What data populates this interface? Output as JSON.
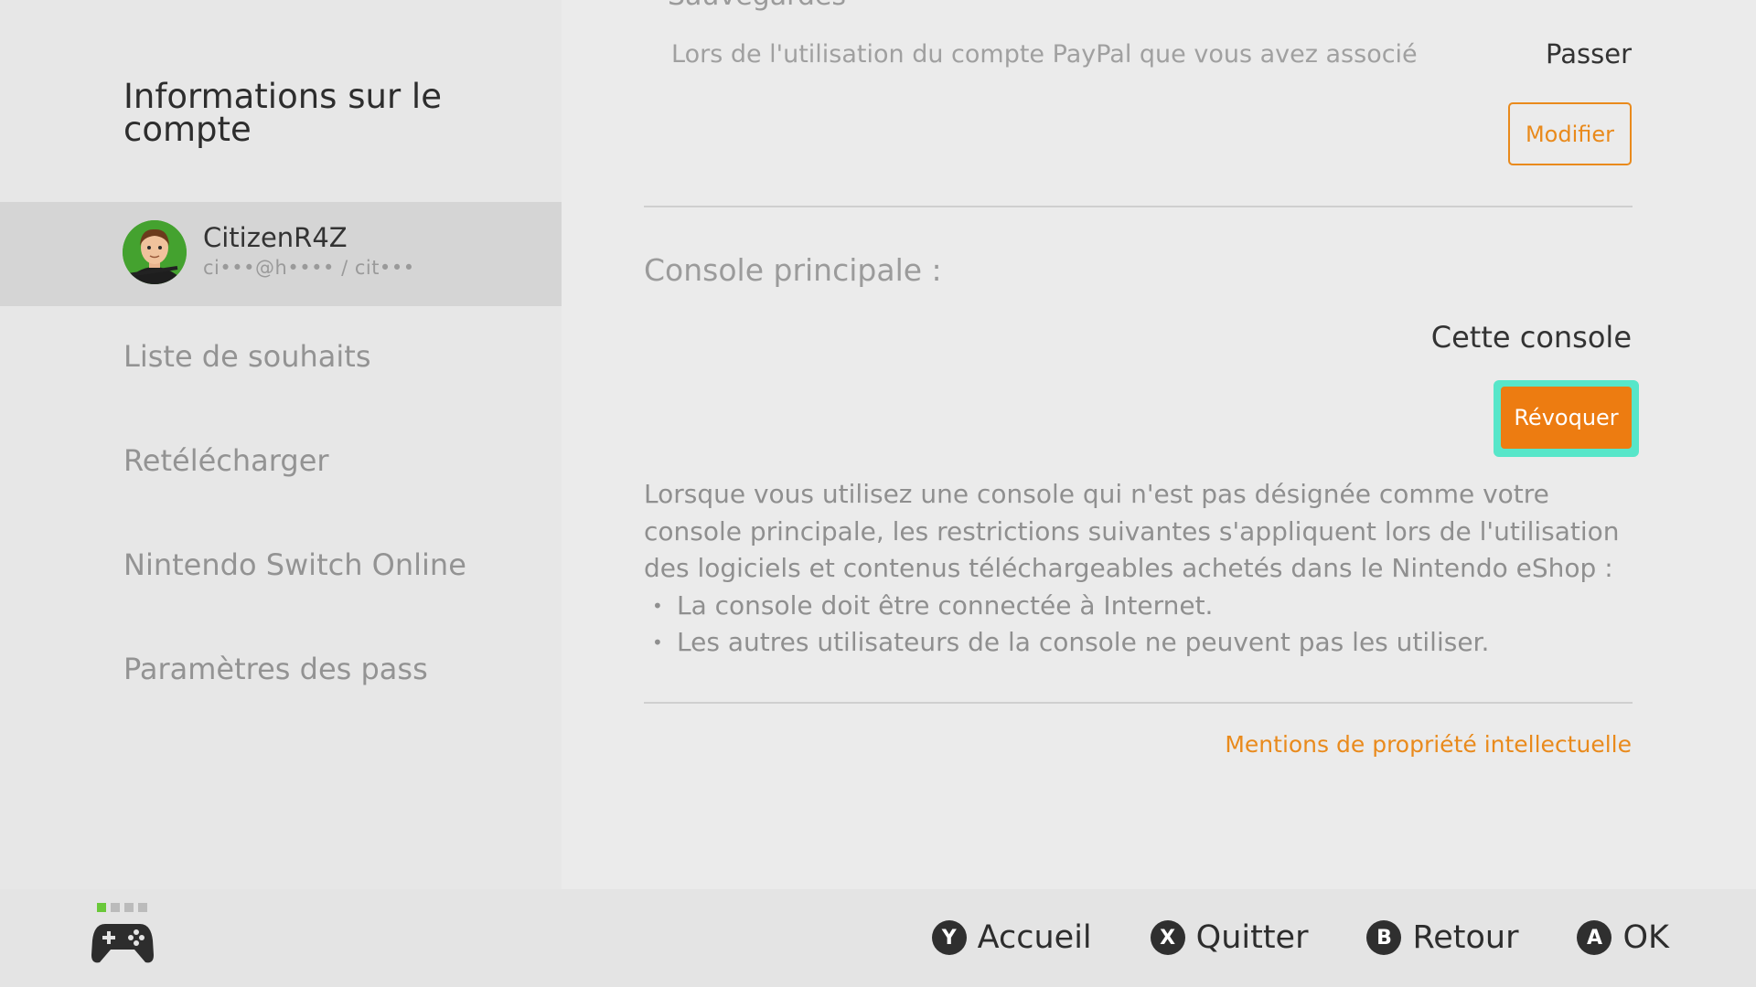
{
  "sidebar": {
    "title": "Informations sur le compte",
    "account": {
      "name": "CitizenR4Z",
      "sub": "ci•••@h•••• / cit•••"
    },
    "items": [
      {
        "label": "Liste de souhaits"
      },
      {
        "label": "Retélécharger"
      },
      {
        "label": "Nintendo Switch Online"
      },
      {
        "label": "Paramètres des pass"
      }
    ]
  },
  "main": {
    "cut_title": "Sauvegardes",
    "payment": {
      "text": "Lors de l'utilisation du compte PayPal que vous avez associé",
      "value": "Passer",
      "button": "Modifier"
    },
    "primary_console": {
      "label": "Console principale :",
      "value": "Cette console",
      "button": "Révoquer",
      "description": "Lorsque vous utilisez une console qui n'est pas désignée comme votre console principale, les restrictions suivantes s'appliquent lors de l'utilisation des logiciels et contenus téléchargeables achetés dans le Nintendo eShop :",
      "bullets": [
        "La console doit être connectée à Internet.",
        "Les autres utilisateurs de la console ne peuvent pas les utiliser."
      ]
    },
    "ip_link": "Mentions de propriété intellectuelle"
  },
  "footer": {
    "controller_icon": "controller-icon",
    "hints": [
      {
        "key": "Y",
        "label": "Accueil"
      },
      {
        "key": "X",
        "label": "Quitter"
      },
      {
        "key": "B",
        "label": "Retour"
      },
      {
        "key": "A",
        "label": "OK"
      }
    ]
  },
  "colors": {
    "accent": "#ED7C11",
    "focus": "#57E6C9",
    "avatar_bg": "#44A22F",
    "player_dot": "#6AC83A"
  }
}
